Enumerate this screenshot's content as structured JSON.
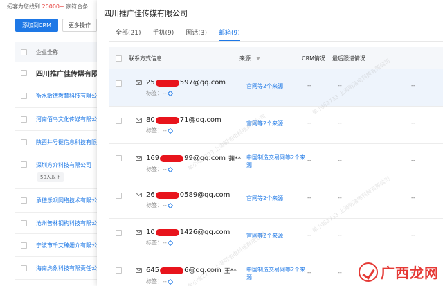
{
  "background": {
    "head_prefix": "拓客为您找到",
    "head_count": "20000+",
    "head_suffix": "家符合条",
    "add_crm": "添加到CRM",
    "more_ops": "更多操作",
    "column_company": "企业全称",
    "rows": [
      {
        "name": "四川推广佳传媒有限"
      },
      {
        "name": "衡水敏德教育科技有限公"
      },
      {
        "name": "河南佰鸟文化传媒有限公"
      },
      {
        "name": "陕西井号键信息科技有限公"
      },
      {
        "name": "深圳方介科技有限公司",
        "tag": "50人以下"
      },
      {
        "name": "承德乐呗网络技术有限公"
      },
      {
        "name": "沧州普林钢构科技有限公"
      },
      {
        "name": "宁波市千艾臻姗介有限公"
      },
      {
        "name": "海南虎象科技有限责任公"
      }
    ]
  },
  "drawer": {
    "title": "四川推广佳传媒有限公司",
    "tabs": [
      {
        "label": "全部(21)"
      },
      {
        "label": "手机(9)"
      },
      {
        "label": "固话(3)"
      },
      {
        "label": "邮箱(9)",
        "active": true
      }
    ],
    "columns": {
      "contact": "联系方式信息",
      "source": "来源",
      "crm": "CRM情况",
      "follow": "最后跟进情况"
    },
    "tag_label": "标签：--",
    "rows": [
      {
        "email_pre": "25",
        "email_post": "597@qq.com",
        "holder": "",
        "source": "官网等2个来源",
        "crm": "--",
        "follow": "--",
        "fourth": "--",
        "selected": true
      },
      {
        "email_pre": "80",
        "email_post": "71@qq.com",
        "holder": "",
        "source": "官网等2个来源",
        "crm": "--",
        "follow": "--",
        "fourth": "--"
      },
      {
        "email_pre": "169",
        "email_post": "99@qq.com",
        "holder": "蒲**",
        "source": "中国制造交易网等2个来源",
        "crm": "--",
        "follow": "--",
        "fourth": "--"
      },
      {
        "email_pre": "26",
        "email_post": "0589@qq.com",
        "holder": "",
        "source": "官网等2个来源",
        "crm": "--",
        "follow": "--",
        "fourth": "--"
      },
      {
        "email_pre": "10",
        "email_post": "1426@qq.com",
        "holder": "",
        "source": "官网等2个来源",
        "crm": "--",
        "follow": "--",
        "fourth": "--"
      },
      {
        "email_pre": "645",
        "email_post": "6@qq.com",
        "holder": "王**",
        "source": "中国制造交易网等2个来源",
        "crm": "--",
        "follow": "--",
        "fourth": "--"
      }
    ]
  },
  "logo": {
    "text": "广西龙网"
  },
  "colors": {
    "primary": "#1e78e6",
    "highlight": "#e53935",
    "redaction": "#e8141c"
  }
}
